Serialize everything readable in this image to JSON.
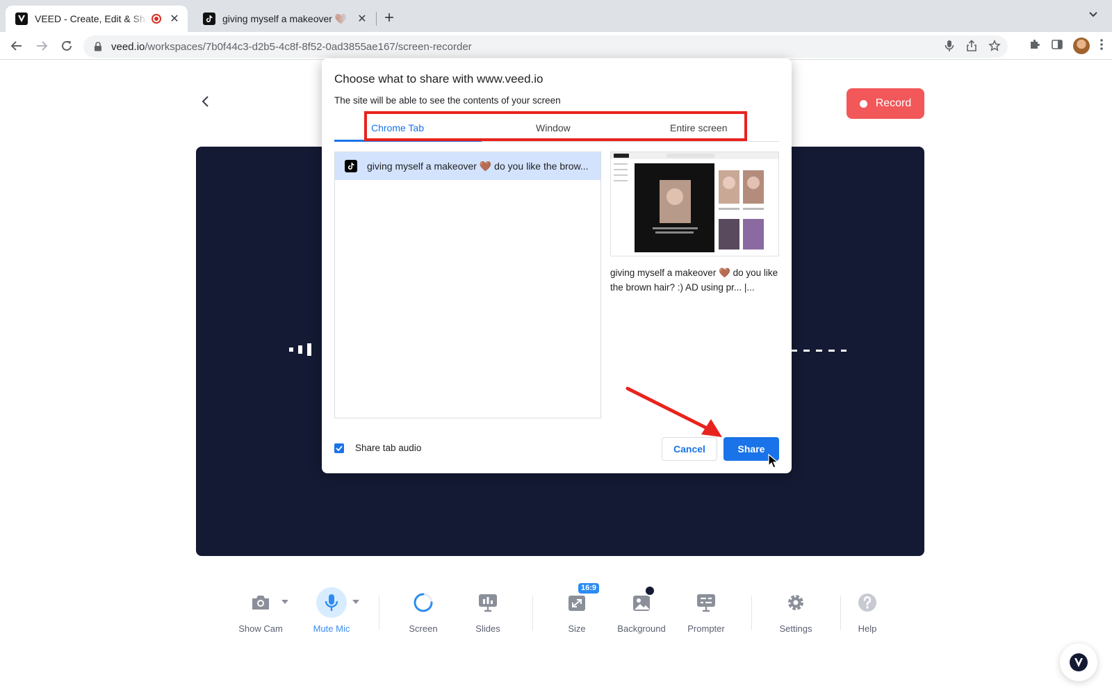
{
  "browser": {
    "tabs": [
      {
        "title": "VEED - Create, Edit & Share"
      },
      {
        "title": "giving myself a makeover 🤎 do you like"
      }
    ],
    "address": {
      "host": "veed.io",
      "path": "/workspaces/7b0f44c3-d2b5-4c8f-8f52-0ad3855ae167/screen-recorder"
    }
  },
  "page": {
    "record_label": "Record",
    "controls": [
      {
        "label": "Show Cam",
        "icon": "camera-icon"
      },
      {
        "label": "Mute Mic",
        "icon": "microphone-icon"
      },
      {
        "label": "Screen",
        "icon": "loading-spinner-icon"
      },
      {
        "label": "Slides",
        "icon": "slides-icon"
      },
      {
        "label": "Size",
        "icon": "resize-icon",
        "badge": "16:9"
      },
      {
        "label": "Background",
        "icon": "background-image-icon"
      },
      {
        "label": "Prompter",
        "icon": "prompter-icon"
      },
      {
        "label": "Settings",
        "icon": "gear-icon"
      },
      {
        "label": "Help",
        "icon": "help-icon"
      }
    ]
  },
  "dialog": {
    "title": "Choose what to share with www.veed.io",
    "subtitle": "The site will be able to see the contents of your screen",
    "tabs": [
      {
        "label": "Chrome Tab",
        "selected": true
      },
      {
        "label": "Window",
        "selected": false
      },
      {
        "label": "Entire screen",
        "selected": false
      }
    ],
    "list": [
      {
        "title": "giving myself a makeover 🤎  do you like the brow..."
      }
    ],
    "preview_caption": "giving myself a makeover 🤎  do you like the brown hair? :) AD using pr... |...",
    "share_audio_label": "Share tab audio",
    "share_audio_checked": true,
    "cancel_label": "Cancel",
    "share_label": "Share"
  },
  "colors": {
    "record": "#f25759",
    "stage": "#141a33",
    "accent": "#1a73e8",
    "annotation": "#e8231e"
  }
}
